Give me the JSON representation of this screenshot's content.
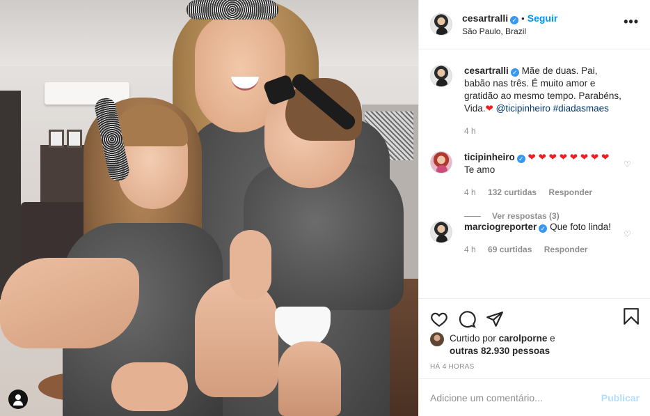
{
  "post": {
    "username": "cesartralli",
    "follow_label": "Seguir",
    "location": "São Paulo, Brazil",
    "more_label": "•••",
    "verified_mark": "✓"
  },
  "caption": {
    "username": "cesartralli",
    "text": "Mãe de duas. Pai, babão nas três. É muito amor e gratidão ao mesmo tempo. Parabéns, Vida.",
    "heart": "❤",
    "tag_user": "@ticipinheiro",
    "hashtag": "#diadasmaes",
    "time": "4 h"
  },
  "comments": [
    {
      "username": "ticipinheiro",
      "hearts": "❤ ❤ ❤ ❤ ❤ ❤ ❤ ❤",
      "text": "Te amo",
      "time": "4 h",
      "likes": "132 curtidas",
      "reply_label": "Responder",
      "view_replies": "Ver respostas (3)"
    },
    {
      "username": "marciogreporter",
      "text": "Que foto linda!",
      "time": "4 h",
      "likes": "69 curtidas",
      "reply_label": "Responder"
    }
  ],
  "likes": {
    "prefix": "Curtido por",
    "user": "carolporne",
    "conjunction": "e",
    "others": "outras 82.930 pessoas"
  },
  "posted_time": "HÁ 4 HORAS",
  "add_comment": {
    "placeholder": "Adicione um comentário...",
    "publish_label": "Publicar"
  },
  "colors": {
    "link": "#0095f6",
    "verified": "#3897f0",
    "heart": "#ed1d24",
    "muted": "#8e8e8e"
  }
}
